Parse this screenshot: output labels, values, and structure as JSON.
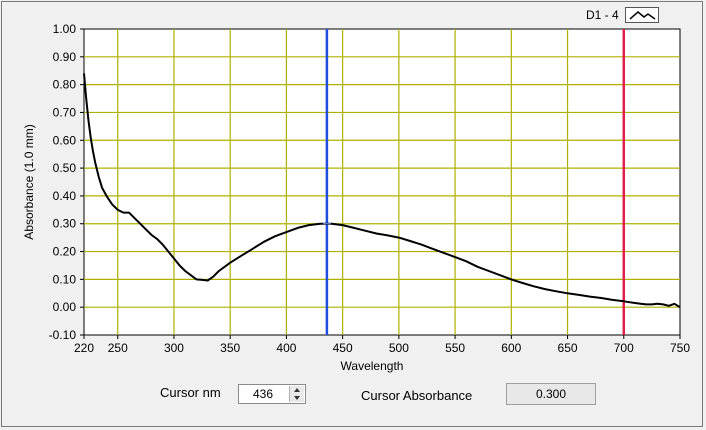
{
  "legend": {
    "label": "D1 - 4",
    "icon": "line-plot-icon"
  },
  "controls": {
    "cursor_nm_label": "Cursor nm",
    "cursor_nm_value": "436",
    "cursor_abs_label": "Cursor Absorbance",
    "cursor_abs_value": "0.300"
  },
  "colors": {
    "trace": "#000000",
    "grid": "#b0b000",
    "cursor1": "#1f4fe0",
    "cursor2": "#e0204a"
  },
  "chart_data": {
    "type": "line",
    "xlabel": "Wavelength",
    "ylabel": "Absorbance (1.0 mm)",
    "xlim": [
      220,
      750
    ],
    "ylim": [
      -0.1,
      1.0
    ],
    "xticks": [
      220,
      250,
      300,
      350,
      400,
      450,
      500,
      550,
      600,
      650,
      700,
      750
    ],
    "yticks": [
      "-0.10",
      "0.00",
      "0.10",
      "0.20",
      "0.30",
      "0.40",
      "0.50",
      "0.60",
      "0.70",
      "0.80",
      "0.90",
      "1.00"
    ],
    "grid": true,
    "cursors": [
      {
        "x": 436,
        "color": "#1f4fe0"
      },
      {
        "x": 700,
        "color": "#e0204a"
      }
    ],
    "series": [
      {
        "x": [
          220,
          222,
          224,
          226,
          228,
          230,
          233,
          236,
          240,
          245,
          250,
          255,
          260,
          265,
          270,
          275,
          280,
          285,
          290,
          295,
          300,
          305,
          310,
          315,
          320,
          325,
          330,
          335,
          340,
          345,
          350,
          360,
          370,
          380,
          390,
          400,
          410,
          420,
          430,
          436,
          440,
          450,
          460,
          470,
          480,
          490,
          500,
          510,
          520,
          530,
          540,
          550,
          560,
          570,
          580,
          590,
          600,
          610,
          620,
          630,
          640,
          650,
          660,
          670,
          680,
          690,
          700,
          705,
          710,
          715,
          720,
          725,
          730,
          735,
          740,
          745,
          750
        ],
        "y": [
          0.84,
          0.75,
          0.67,
          0.61,
          0.56,
          0.52,
          0.47,
          0.43,
          0.4,
          0.37,
          0.35,
          0.34,
          0.34,
          0.32,
          0.3,
          0.28,
          0.26,
          0.245,
          0.225,
          0.2,
          0.175,
          0.15,
          0.13,
          0.115,
          0.1,
          0.098,
          0.096,
          0.11,
          0.13,
          0.145,
          0.16,
          0.185,
          0.21,
          0.235,
          0.255,
          0.27,
          0.285,
          0.295,
          0.3,
          0.3,
          0.3,
          0.295,
          0.285,
          0.275,
          0.265,
          0.258,
          0.25,
          0.238,
          0.225,
          0.21,
          0.195,
          0.18,
          0.165,
          0.145,
          0.13,
          0.115,
          0.1,
          0.087,
          0.075,
          0.065,
          0.057,
          0.05,
          0.044,
          0.038,
          0.033,
          0.026,
          0.021,
          0.018,
          0.015,
          0.012,
          0.01,
          0.01,
          0.012,
          0.01,
          0.005,
          0.012,
          0.0
        ]
      }
    ]
  }
}
